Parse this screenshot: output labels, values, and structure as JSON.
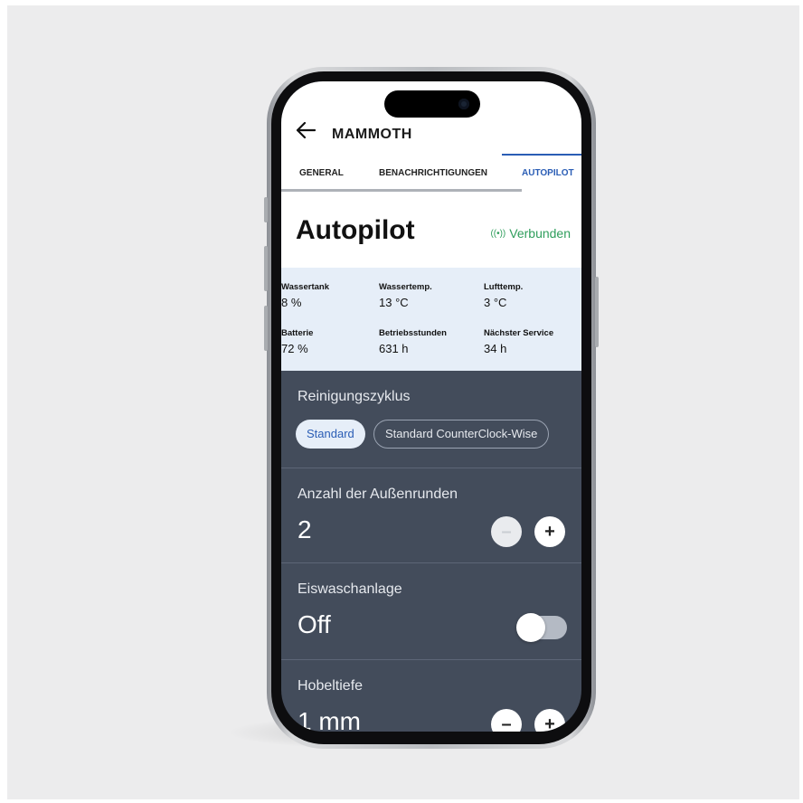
{
  "app": {
    "title": "MAMMOTH",
    "back_icon": "arrow-left-icon"
  },
  "tabs": [
    {
      "label": "GENERAL",
      "active": false
    },
    {
      "label": "BENACHRICHTIGUNGEN",
      "active": false
    },
    {
      "label": "AUTOPILOT",
      "active": true
    }
  ],
  "header": {
    "title": "Autopilot",
    "status_icon": "broadcast-signal-icon",
    "status_icon_glyph": "((•))",
    "status_text": "Verbunden",
    "status_color": "#2f9e5c"
  },
  "stats": [
    {
      "label": "Wassertank",
      "value": "8 %"
    },
    {
      "label": "Wassertemp.",
      "value": "13 °C"
    },
    {
      "label": "Lufttemp.",
      "value": "3 °C"
    },
    {
      "label": "Batterie",
      "value": "72 %"
    },
    {
      "label": "Betriebsstunden",
      "value": "631 h"
    },
    {
      "label": "Nächster Service",
      "value": "34 h"
    }
  ],
  "cleaning_cycle": {
    "label": "Reinigungszyklus",
    "options": [
      {
        "label": "Standard",
        "selected": true
      },
      {
        "label": "Standard CounterClock-Wise",
        "selected": false
      }
    ]
  },
  "outer_rounds": {
    "label": "Anzahl der Außenrunden",
    "value": "2",
    "decrement_glyph": "–",
    "increment_glyph": "+",
    "decrement_enabled": false
  },
  "ice_wash": {
    "label": "Eiswaschanlage",
    "value": "Off",
    "toggle_on": false
  },
  "planing_depth": {
    "label": "Hobeltiefe",
    "value": "1 mm",
    "decrement_glyph": "–",
    "increment_glyph": "+"
  },
  "colors": {
    "accent": "#2a5db5",
    "panel_background": "#434c5b",
    "stats_background": "#e6eef8"
  }
}
